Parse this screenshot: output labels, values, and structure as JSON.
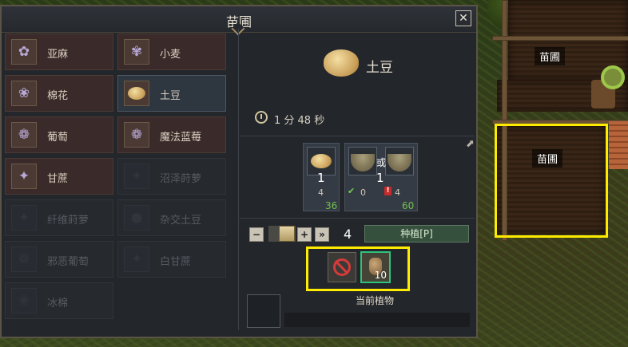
{
  "window": {
    "title": "苗圃",
    "close_label": "✕"
  },
  "world": {
    "field_labels": [
      "苗圃",
      "苗圃"
    ]
  },
  "crops": [
    {
      "label": "亚麻",
      "icon": "flax-icon",
      "glyph": "✿",
      "state": "available"
    },
    {
      "label": "小麦",
      "icon": "wheat-icon",
      "glyph": "✾",
      "state": "available"
    },
    {
      "label": "棉花",
      "icon": "cotton-icon",
      "glyph": "❀",
      "state": "available"
    },
    {
      "label": "土豆",
      "icon": "potato-icon",
      "glyph": "",
      "state": "selected"
    },
    {
      "label": "葡萄",
      "icon": "grape-icon",
      "glyph": "❁",
      "state": "available"
    },
    {
      "label": "魔法蓝莓",
      "icon": "magic-blueberry-icon",
      "glyph": "❁",
      "state": "available"
    },
    {
      "label": "甘蔗",
      "icon": "sugarcane-icon",
      "glyph": "✦",
      "state": "available"
    },
    {
      "label": "沼泽莳萝",
      "icon": "swamp-dill-icon",
      "glyph": "✦",
      "state": "locked"
    },
    {
      "label": "纤维莳萝",
      "icon": "fiber-dill-icon",
      "glyph": "✦",
      "state": "locked"
    },
    {
      "label": "杂交土豆",
      "icon": "hybrid-potato-icon",
      "glyph": "●",
      "state": "locked"
    },
    {
      "label": "邪恶葡萄",
      "icon": "evil-grape-icon",
      "glyph": "❁",
      "state": "locked"
    },
    {
      "label": "白甘蔗",
      "icon": "white-sugarcane-icon",
      "glyph": "✦",
      "state": "locked"
    },
    {
      "label": "冰棉",
      "icon": "ice-cotton-icon",
      "glyph": "❀",
      "state": "locked"
    }
  ],
  "detail": {
    "name": "土豆",
    "time": "1 分 48 秒",
    "or_text": "或",
    "resources": [
      {
        "icon": "potato-seed-icon",
        "qty": "1",
        "have": "4",
        "need": "36"
      },
      {
        "icon": "bowl-icon",
        "qty": "1",
        "have_a": "0",
        "have_b": "4",
        "need": "60"
      }
    ],
    "count": "4",
    "plant_label": "种植[P]",
    "current_label": "当前植物",
    "fertilizer_count": "10"
  },
  "colors": {
    "highlight": "#ffeb00",
    "active_slot": "#2fc27a",
    "need_text": "#70c24d"
  }
}
